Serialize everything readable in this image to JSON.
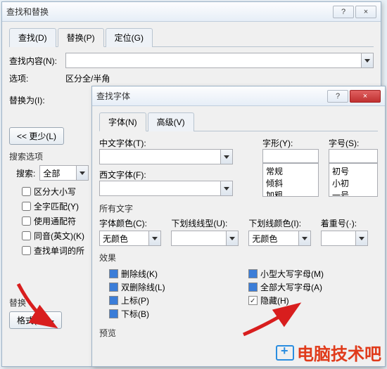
{
  "find_dialog": {
    "title": "查找和替换",
    "help_btn": "?",
    "close_btn": "×",
    "tabs": {
      "find": "查找(D)",
      "replace": "替换(P)",
      "goto": "定位(G)"
    },
    "find_label": "查找内容(N):",
    "options_label": "选项:",
    "options_value": "区分全/半角",
    "replace_label": "替换为(I):",
    "less_btn": "<<  更少(L)",
    "search_options_title": "搜索选项",
    "search_label": "搜索:",
    "search_value": "全部",
    "checks": {
      "case": "区分大小写",
      "whole": "全字匹配(Y)",
      "wildcard": "使用通配符",
      "sounds": "同音(英文)(K)",
      "forms": "查找单词的所"
    },
    "replace_section": "替换",
    "format_btn": "格式(O)"
  },
  "font_dialog": {
    "title": "查找字体",
    "help_btn": "?",
    "close_btn": "×",
    "tabs": {
      "font": "字体(N)",
      "advanced": "高级(V)"
    },
    "cjk_font_label": "中文字体(T):",
    "latin_font_label": "西文字体(F):",
    "style_label": "字形(Y):",
    "style_values": [
      "常规",
      "倾斜",
      "加粗"
    ],
    "size_label": "字号(S):",
    "size_values": [
      "初号",
      "小初",
      "一号"
    ],
    "all_text_title": "所有文字",
    "font_color_label": "字体颜色(C):",
    "font_color_value": "无颜色",
    "underline_style_label": "下划线线型(U):",
    "underline_style_value": "",
    "underline_color_label": "下划线颜色(I):",
    "underline_color_value": "无颜色",
    "emphasis_label": "着重号(·):",
    "emphasis_value": "",
    "effects_title": "效果",
    "effects": {
      "strike": "删除线(K)",
      "dstrike": "双删除线(L)",
      "super": "上标(P)",
      "sub": "下标(B)",
      "smallcaps": "小型大写字母(M)",
      "allcaps": "全部大写字母(A)",
      "hidden": "隐藏(H)"
    },
    "preview_title": "预览"
  },
  "watermark": "电脑技术吧"
}
